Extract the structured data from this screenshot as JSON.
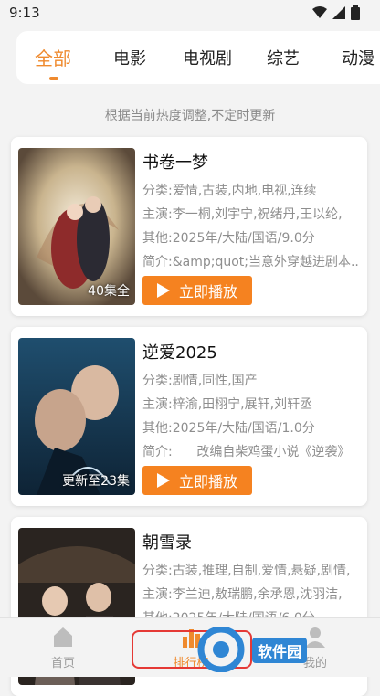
{
  "status_bar": {
    "time": "9:13"
  },
  "tabs": [
    {
      "label": "全部",
      "active": true
    },
    {
      "label": "电影",
      "active": false
    },
    {
      "label": "电视剧",
      "active": false
    },
    {
      "label": "综艺",
      "active": false
    },
    {
      "label": "动漫",
      "active": false
    }
  ],
  "hint": "根据当前热度调整,不定时更新",
  "play_label": "立即播放",
  "cards": [
    {
      "title": "书卷一梦",
      "category": "分类:爱情,古装,内地,电视,连续",
      "cast": "主演:李一桐,刘宇宁,祝绪丹,王以纶,",
      "other": "其他:2025年/大陆/国语/9.0分",
      "intro": "简介:&amp;quot;当意外穿越进剧本...",
      "badge": "40集全"
    },
    {
      "title": "逆爱2025",
      "category": "分类:剧情,同性,国产",
      "cast": "主演:梓渝,田栩宁,展轩,刘轩丞",
      "other": "其他:2025年/大陆/国语/1.0分",
      "intro": "简介:      改编自柴鸡蛋小说《逆袭》",
      "badge": "更新至23集"
    },
    {
      "title": "朝雪录",
      "category": "分类:古装,推理,自制,爱情,悬疑,剧情,",
      "cast": "主演:李兰迪,敖瑞鹏,余承恩,沈羽洁,",
      "other": "其他:2025年/大陆/国语/6.0分",
      "intro": "",
      "badge": ""
    }
  ],
  "bottom_nav": [
    {
      "label": "首页",
      "icon": "home-icon",
      "active": false
    },
    {
      "label": "排行榜",
      "icon": "ranking-icon",
      "active": true
    },
    {
      "label": "我的",
      "icon": "profile-icon",
      "active": false
    }
  ],
  "watermark": {
    "text": "软件园"
  },
  "colors": {
    "accent": "#ef8a2e",
    "play_button": "#f58220",
    "highlight_box": "#e53935"
  }
}
